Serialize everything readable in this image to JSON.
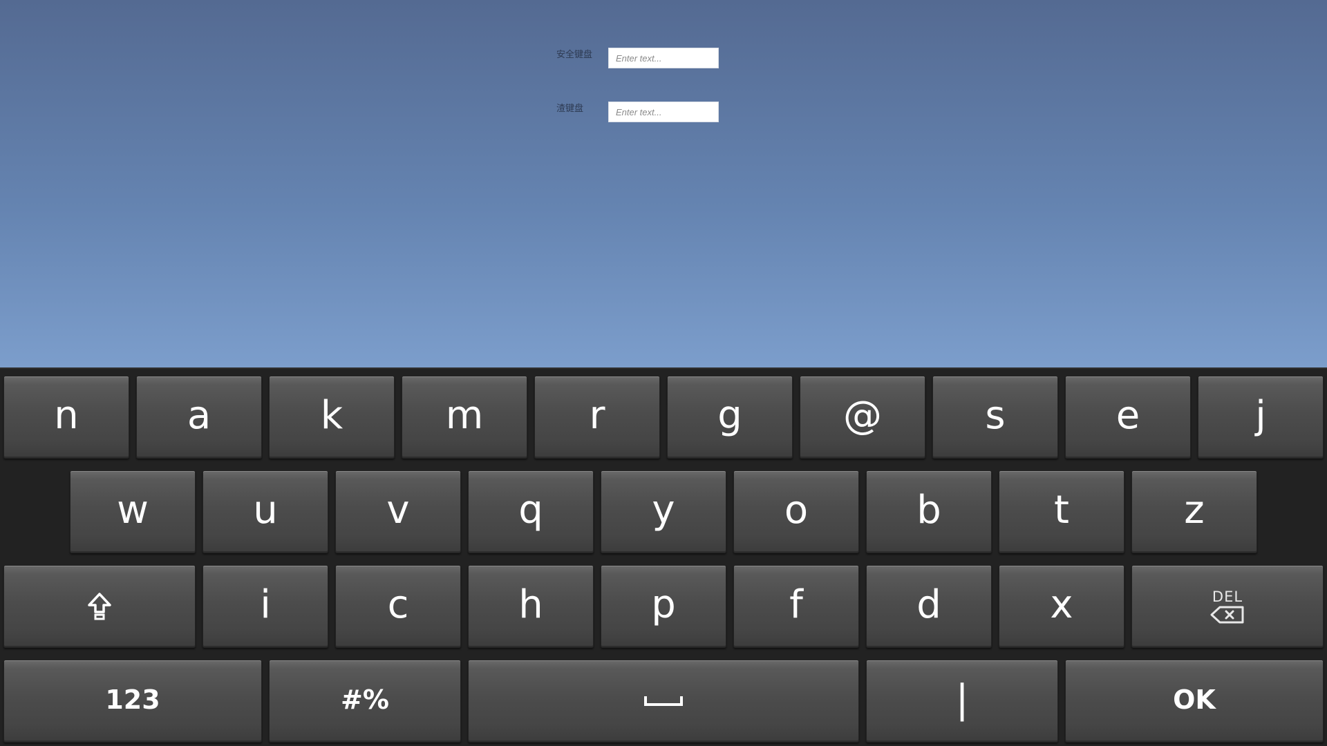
{
  "form": {
    "fields": [
      {
        "label": "安全键盘",
        "placeholder": "Enter text..."
      },
      {
        "label": "渣键盘",
        "placeholder": "Enter text..."
      }
    ]
  },
  "keyboard": {
    "row1": [
      "n",
      "a",
      "k",
      "m",
      "r",
      "g",
      "@",
      "s",
      "e",
      "j"
    ],
    "row2": [
      "w",
      "u",
      "v",
      "q",
      "y",
      "o",
      "b",
      "t",
      "z"
    ],
    "row3": [
      "i",
      "c",
      "h",
      "p",
      "f",
      "d",
      "x"
    ],
    "del_label": "DEL",
    "numbers_label": "123",
    "symbols_label": "#%",
    "pipe_label": "|",
    "ok_label": "OK",
    "icons": {
      "shift": "shift-arrow-up-icon",
      "backspace": "backspace-icon",
      "space": "space-bar-icon"
    }
  },
  "colors": {
    "sky_top": "#546a92",
    "sky_bottom": "#e6f9ff",
    "keyboard_bg": "#222222",
    "key_face": "#4c4c4c",
    "key_text": "#ffffff"
  }
}
